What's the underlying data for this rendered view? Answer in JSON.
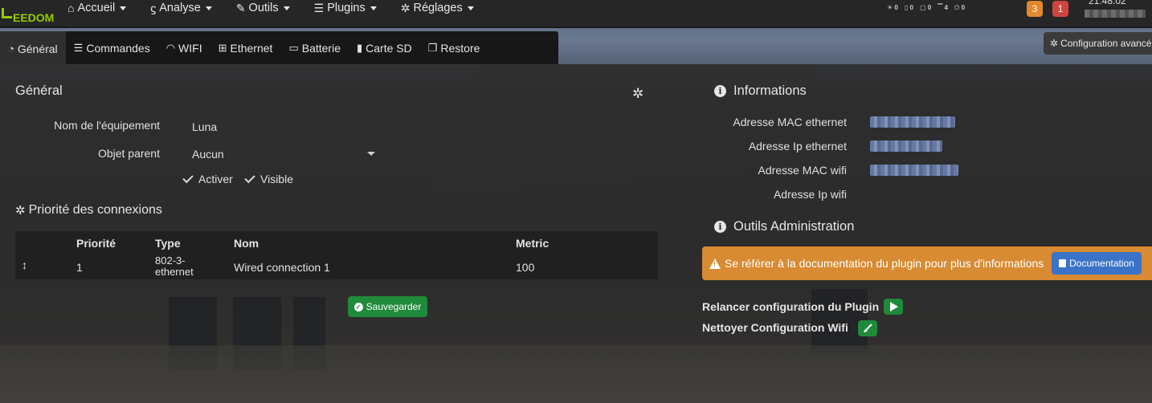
{
  "navbar": {
    "brand": "EEDOM",
    "menu": [
      {
        "icon": "home-icon",
        "glyph": "⌂",
        "label": "Accueil"
      },
      {
        "icon": "stethoscope-icon",
        "glyph": "ϛ",
        "label": "Analyse"
      },
      {
        "icon": "wrench-icon",
        "glyph": "✎",
        "label": "Outils"
      },
      {
        "icon": "list-icon",
        "glyph": "☰",
        "label": "Plugins"
      },
      {
        "icon": "cogs-icon",
        "glyph": "✲",
        "label": "Réglages"
      }
    ],
    "status": [
      "0",
      "0",
      "0",
      "4",
      "0"
    ],
    "badge_warning": "3",
    "badge_alert": "1",
    "clock": "21:48:02"
  },
  "tabs": [
    {
      "icon": "dashboard-icon",
      "glyph": "◔",
      "label": "Général"
    },
    {
      "icon": "list-icon",
      "glyph": "☰",
      "label": "Commandes"
    },
    {
      "icon": "wifi-icon",
      "glyph": "◠",
      "label": "WIFI"
    },
    {
      "icon": "network-icon",
      "glyph": "⊞",
      "label": "Ethernet"
    },
    {
      "icon": "battery-icon",
      "glyph": "▭",
      "label": "Batterie"
    },
    {
      "icon": "sd-card-icon",
      "glyph": "▮",
      "label": "Carte SD"
    },
    {
      "icon": "clone-icon",
      "glyph": "❐",
      "label": "Restore"
    }
  ],
  "config_avancee": "Configuration avancée",
  "general": {
    "title": "Général",
    "nom_label": "Nom de l'équipement",
    "nom_value": "Luna",
    "objet_label": "Objet parent",
    "objet_value": "Aucun",
    "activer": "Activer",
    "visible": "Visible"
  },
  "priorite": {
    "title": "Priorité des connexions",
    "headers": [
      "Priorité",
      "Type",
      "Nom",
      "Metric"
    ],
    "row": {
      "priorite": "1",
      "type_line1": "802-3-",
      "type_line2": "ethernet",
      "nom": "Wired connection 1",
      "metric": "100"
    }
  },
  "save_button": "Sauvegarder",
  "informations": {
    "title": "Informations",
    "labels": [
      "Adresse MAC ethernet",
      "Adresse Ip ethernet",
      "Adresse MAC wifi",
      "Adresse Ip wifi"
    ]
  },
  "admin": {
    "title": "Outils Administration",
    "alert": "Se référer à la documentation du plugin pour plus d'informations",
    "doc_button": "Documentation",
    "relancer": "Relancer configuration du Plugin",
    "nettoyer": "Nettoyer Configuration Wifi"
  },
  "colors": {
    "accent_green": "#1f8a3a",
    "warning": "#d88b32",
    "primary": "#3a73c8",
    "brand": "#94ca02"
  }
}
